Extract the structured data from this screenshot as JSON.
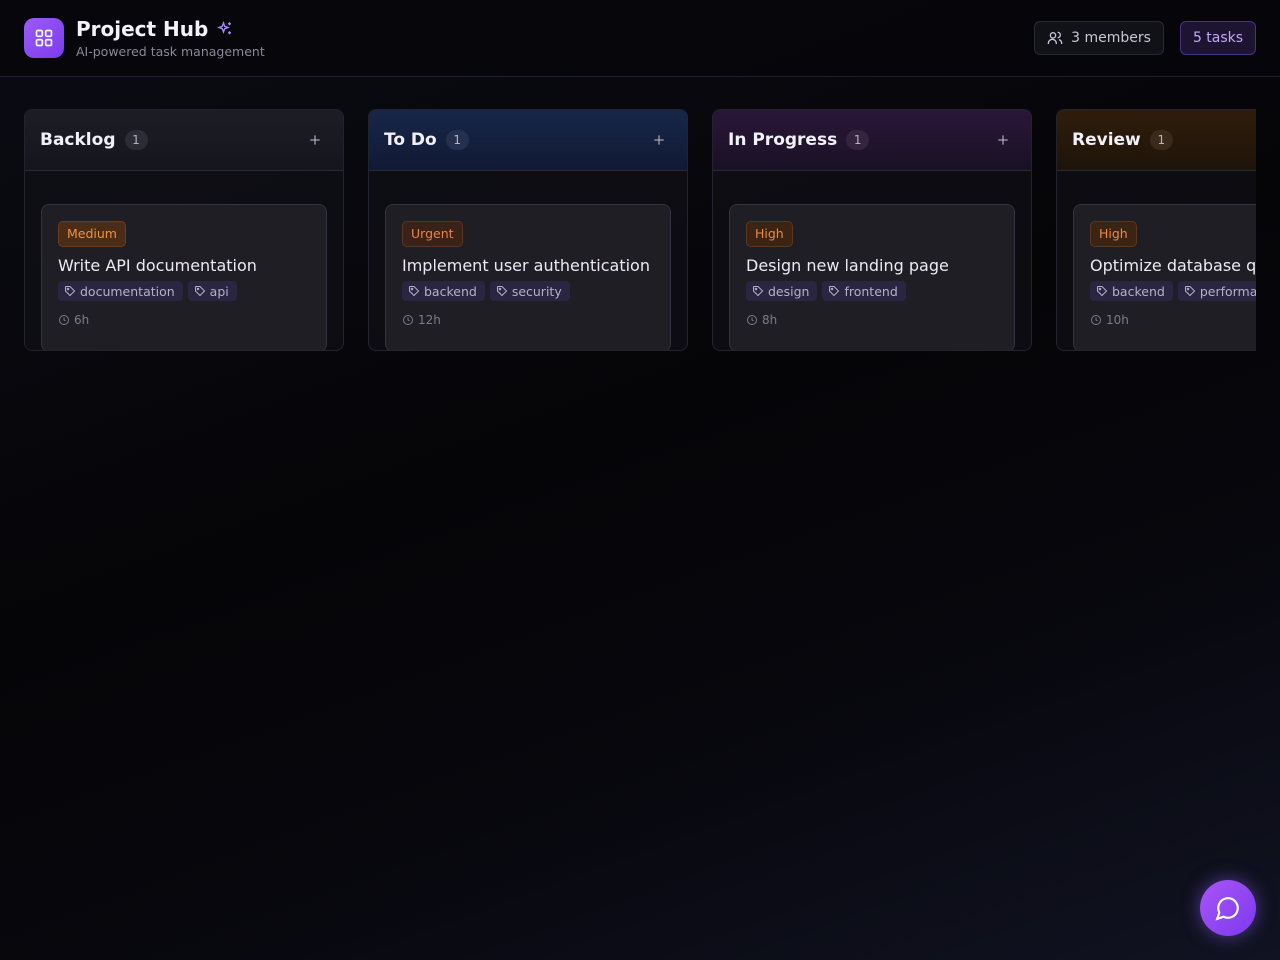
{
  "header": {
    "title": "Project Hub",
    "subtitle": "AI-powered task management",
    "members_label": "3 members",
    "tasks_label": "5 tasks",
    "logo_icon": "grid-icon",
    "title_icon": "sparkles-icon"
  },
  "columns": [
    {
      "title": "Backlog",
      "count": "1",
      "head_color": "#1a1a22",
      "card": {
        "priority": "Medium",
        "priority_level": "medium",
        "title": "Write API documentation",
        "tags": [
          "documentation",
          "api"
        ],
        "estimate": "6h"
      }
    },
    {
      "title": "To Do",
      "count": "1",
      "head_color": "#142040",
      "card": {
        "priority": "Urgent",
        "priority_level": "urgent",
        "title": "Implement user authentication",
        "tags": [
          "backend",
          "security"
        ],
        "estimate": "12h"
      }
    },
    {
      "title": "In Progress",
      "count": "1",
      "head_color": "#23152e",
      "card": {
        "priority": "High",
        "priority_level": "high",
        "title": "Design new landing page",
        "tags": [
          "design",
          "frontend"
        ],
        "estimate": "8h"
      }
    },
    {
      "title": "Review",
      "count": "1",
      "head_color": "#2a1a0a",
      "card": {
        "priority": "High",
        "priority_level": "high",
        "title": "Optimize database queries",
        "tags": [
          "backend",
          "performance"
        ],
        "estimate": "10h"
      }
    }
  ],
  "icons": {
    "add": "plus-icon",
    "tag": "tag-icon",
    "time": "clock-icon",
    "members": "users-icon",
    "chat": "chat-bubble-icon"
  },
  "colors": {
    "accent": "#8b5cf6",
    "priority_medium": "#f0923a",
    "priority_urgent": "#e7844c",
    "priority_high": "#e98a45"
  }
}
